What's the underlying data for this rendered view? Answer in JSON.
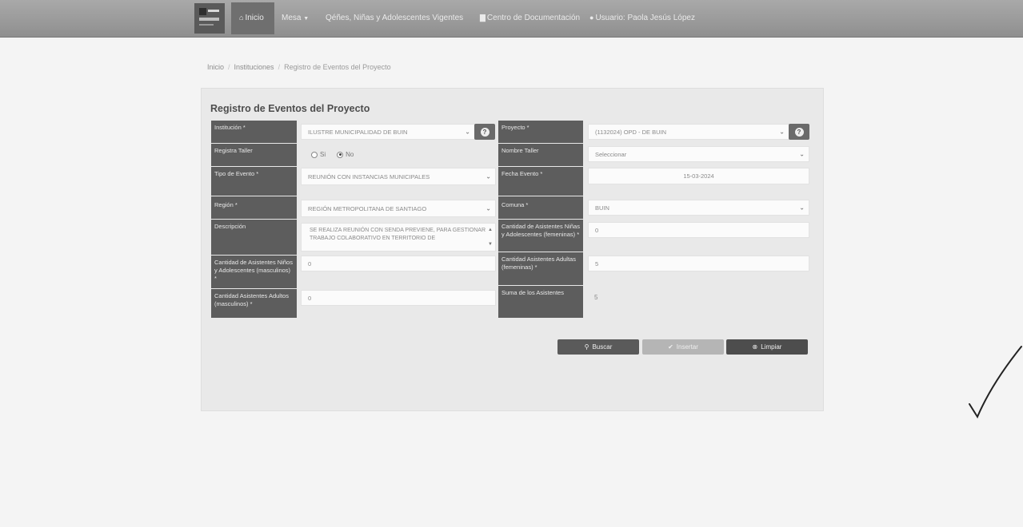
{
  "navbar": {
    "items": [
      {
        "icon": "home-icon",
        "label": "Inicio"
      },
      {
        "label": "Mesa",
        "caret": "▼"
      },
      {
        "label": "Qéñes, Niñas y Adolescentes Vigentes"
      },
      {
        "icon": "document-icon",
        "label": "Centro de Documentación"
      },
      {
        "icon": "user-icon",
        "label": "Usuario: Paola Jesús López"
      }
    ]
  },
  "breadcrumb": [
    "Inicio",
    "Instituciones",
    "Registro de Eventos del Proyecto"
  ],
  "page_title": "Registro de Eventos del Proyecto",
  "form": {
    "institucion": {
      "label": "Institución *",
      "value": "ILUSTRE MUNICIPALIDAD DE BUIN"
    },
    "registra_taller": {
      "label": "Registra Taller",
      "options": [
        "Si",
        "No"
      ],
      "selected": "No"
    },
    "tipo_evento": {
      "label": "Tipo de Evento *",
      "value": "REUNIÓN CON INSTANCIAS MUNICIPALES"
    },
    "region": {
      "label": "Región *",
      "value": "REGIÓN METROPOLITANA DE SANTIAGO"
    },
    "descripcion": {
      "label": "Descripción",
      "value": "SE REALIZA REUNIÓN CON SENDA PREVIENE, PARA GESTIONAR TRABAJO COLABORATIVO EN TERRITORIO DE"
    },
    "ninos_masculino": {
      "label": "Cantidad de Asistentes Niños y Adolescentes (masculinos) *",
      "value": "0"
    },
    "adultos_masculino": {
      "label": "Cantidad Asistentes Adultos (masculinos) *",
      "value": "0"
    },
    "proyecto": {
      "label": "Proyecto *",
      "value": "(1132024) OPD - DE BUIN"
    },
    "nombre_taller": {
      "label": "Nombre Taller",
      "value": "Seleccionar"
    },
    "fecha_evento": {
      "label": "Fecha Evento *",
      "value": "15-03-2024"
    },
    "comuna": {
      "label": "Comuna *",
      "value": "BUIN"
    },
    "ninas_femenino": {
      "label": "Cantidad de Asistentes Niñas y Adolescentes (femeninas) *",
      "value": "0"
    },
    "adultas_femenino": {
      "label": "Cantidad Asistentes Adultas (femeninas) *",
      "value": "5"
    },
    "suma_asistentes": {
      "label": "Suma de los Asistentes",
      "value": "5"
    }
  },
  "buttons": {
    "search": "Buscar",
    "insert": "Insertar",
    "clear": "Limpiar"
  }
}
